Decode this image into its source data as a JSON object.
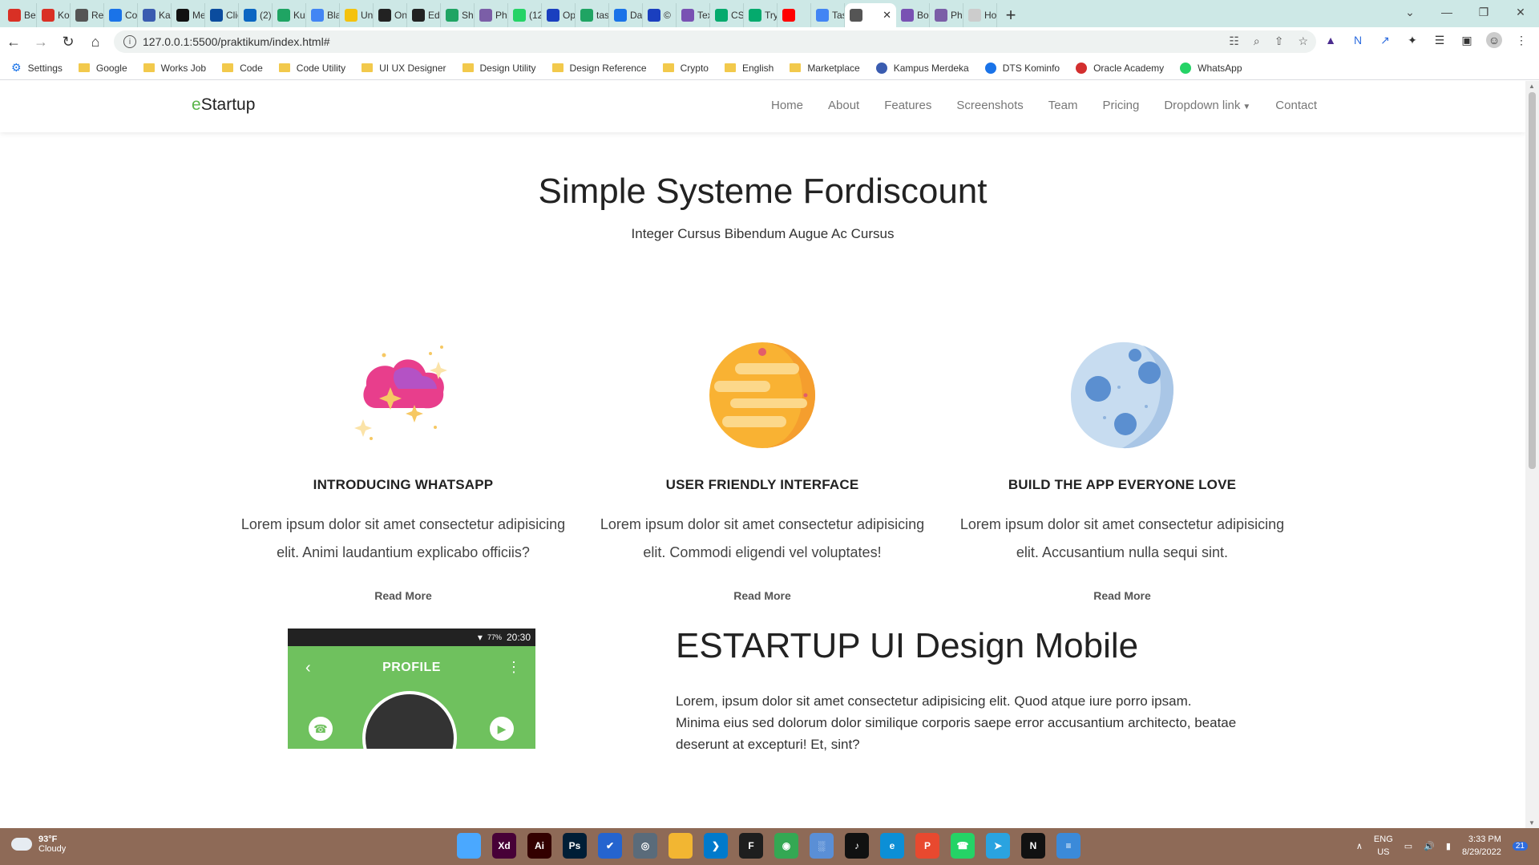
{
  "browser": {
    "tabs": [
      {
        "label": "Ber",
        "icon": "gmail-icon",
        "color": "#d93025"
      },
      {
        "label": "Kol",
        "icon": "gmail-icon",
        "color": "#d93025"
      },
      {
        "label": "Reg",
        "icon": "clock-icon",
        "color": "#555555"
      },
      {
        "label": "Co",
        "icon": "c-icon",
        "color": "#1a73e8"
      },
      {
        "label": "Kar",
        "icon": "karir-icon",
        "color": "#3a5cb0"
      },
      {
        "label": "Me",
        "icon": "medium-icon",
        "color": "#111111"
      },
      {
        "label": "Clic",
        "icon": "click-icon",
        "color": "#0b4c9e"
      },
      {
        "label": "(2)",
        "icon": "linkedin-icon",
        "color": "#0a66c2"
      },
      {
        "label": "Kul",
        "icon": "drive-icon",
        "color": "#1fa463"
      },
      {
        "label": "Bla",
        "icon": "docs-icon",
        "color": "#4285f4"
      },
      {
        "label": "Uni",
        "icon": "smile-icon",
        "color": "#f4c20d"
      },
      {
        "label": "On",
        "icon": "d-icon",
        "color": "#222222"
      },
      {
        "label": "Edi",
        "icon": "github-icon",
        "color": "#222222"
      },
      {
        "label": "Sha",
        "icon": "drive-icon",
        "color": "#1fa463"
      },
      {
        "label": "Phi",
        "icon": "grid-icon",
        "color": "#7b5ea7"
      },
      {
        "label": "(12",
        "icon": "whatsapp-icon",
        "color": "#25d366"
      },
      {
        "label": "Op",
        "icon": "b-icon",
        "color": "#1a3fbf"
      },
      {
        "label": "tas",
        "icon": "drive-icon",
        "color": "#1fa463"
      },
      {
        "label": "Da",
        "icon": "download-icon",
        "color": "#1a73e8"
      },
      {
        "label": "©",
        "icon": "heart-icon",
        "color": "#1a3fbf"
      },
      {
        "label": "Tex",
        "icon": "bootstrap-icon",
        "color": "#7952b3"
      },
      {
        "label": "CSS",
        "icon": "w-icon",
        "color": "#04aa6d"
      },
      {
        "label": "Try",
        "icon": "w-icon",
        "color": "#04aa6d"
      },
      {
        "label": "",
        "icon": "youtube-icon",
        "color": "#ff0000"
      },
      {
        "label": "Tas",
        "icon": "docs-icon",
        "color": "#4285f4"
      },
      {
        "label": "",
        "icon": "globe-icon",
        "color": "#555555",
        "active": true
      },
      {
        "label": "Bo",
        "icon": "bootstrap-icon",
        "color": "#7952b3"
      },
      {
        "label": "Phi",
        "icon": "grid-icon",
        "color": "#7b5ea7"
      },
      {
        "label": "Ho",
        "icon": "page-icon",
        "color": "#cccccc"
      }
    ],
    "url": "127.0.0.1:5500/praktikum/index.html#",
    "bookmarks": [
      {
        "label": "Settings",
        "type": "gear"
      },
      {
        "label": "Google",
        "type": "folder"
      },
      {
        "label": "Works Job",
        "type": "folder"
      },
      {
        "label": "Code",
        "type": "folder"
      },
      {
        "label": "Code Utility",
        "type": "folder"
      },
      {
        "label": "UI UX Designer",
        "type": "folder"
      },
      {
        "label": "Design Utility",
        "type": "folder"
      },
      {
        "label": "Design Reference",
        "type": "folder"
      },
      {
        "label": "Crypto",
        "type": "folder"
      },
      {
        "label": "English",
        "type": "folder"
      },
      {
        "label": "Marketplace",
        "type": "folder"
      },
      {
        "label": "Kampus Merdeka",
        "type": "site",
        "color": "#3a5cb0"
      },
      {
        "label": "DTS Kominfo",
        "type": "site",
        "color": "#1a73e8"
      },
      {
        "label": "Oracle Academy",
        "type": "site",
        "color": "#d32f2f"
      },
      {
        "label": "WhatsApp",
        "type": "site",
        "color": "#25d366"
      }
    ]
  },
  "site": {
    "brand_e": "e",
    "brand_rest": "Startup",
    "nav": [
      "Home",
      "About",
      "Features",
      "Screenshots",
      "Team",
      "Pricing",
      "Dropdown link",
      "Contact"
    ],
    "hero_title": "Simple Systeme Fordiscount",
    "hero_subtitle": "Integer Cursus Bibendum Augue Ac Cursus",
    "features": [
      {
        "title": "INTRODUCING WHATSAPP",
        "text": "Lorem ipsum dolor sit amet consectetur adipisicing elit. Animi laudantium explicabo officiis?",
        "link": "Read More"
      },
      {
        "title": "USER FRIENDLY INTERFACE",
        "text": "Lorem ipsum dolor sit amet consectetur adipisicing elit. Commodi eligendi vel voluptates!",
        "link": "Read More"
      },
      {
        "title": "BUILD THE APP EVERYONE LOVE",
        "text": "Lorem ipsum dolor sit amet consectetur adipisicing elit. Accusantium nulla sequi sint.",
        "link": "Read More"
      }
    ],
    "phone": {
      "status_battery": "77%",
      "status_time": "20:30",
      "title": "PROFILE"
    },
    "mobile_title": "ESTARTUP UI Design Mobile",
    "mobile_text": "Lorem, ipsum dolor sit amet consectetur adipisicing elit. Quod atque iure porro ipsam. Minima eius sed dolorum dolor similique corporis saepe error accusantium architecto, beatae deserunt at excepturi! Et, sint?"
  },
  "taskbar": {
    "weather_temp": "93°F",
    "weather_desc": "Cloudy",
    "lang_top": "ENG",
    "lang_bottom": "US",
    "time": "3:33 PM",
    "date": "8/29/2022",
    "notif_count": "21",
    "apps": [
      {
        "label": "",
        "icon": "windows-icon",
        "color": "#4aa8ff"
      },
      {
        "label": "Xd",
        "icon": "xd-icon",
        "color": "#470137"
      },
      {
        "label": "Ai",
        "icon": "illustrator-icon",
        "color": "#330000"
      },
      {
        "label": "Ps",
        "icon": "photoshop-icon",
        "color": "#001e36"
      },
      {
        "label": "✔",
        "icon": "todo-icon",
        "color": "#2564cf"
      },
      {
        "label": "◎",
        "icon": "settings-icon",
        "color": "#5a6b7a"
      },
      {
        "label": "",
        "icon": "explorer-icon",
        "color": "#f2b632"
      },
      {
        "label": "❯",
        "icon": "vscode-icon",
        "color": "#007acc"
      },
      {
        "label": "F",
        "icon": "figma-icon",
        "color": "#1e1e1e"
      },
      {
        "label": "◉",
        "icon": "chrome-icon",
        "color": "#34a853"
      },
      {
        "label": "░",
        "icon": "photos-icon",
        "color": "#5a8fd6"
      },
      {
        "label": "♪",
        "icon": "tiktok-icon",
        "color": "#111111"
      },
      {
        "label": "e",
        "icon": "edge-icon",
        "color": "#0c8fd6"
      },
      {
        "label": "P",
        "icon": "office-icon",
        "color": "#e8492f"
      },
      {
        "label": "☎",
        "icon": "whatsapp-icon",
        "color": "#25d366"
      },
      {
        "label": "➤",
        "icon": "telegram-icon",
        "color": "#2aa3e0"
      },
      {
        "label": "N",
        "icon": "notion-icon",
        "color": "#111111"
      },
      {
        "label": "≡",
        "icon": "notepad-icon",
        "color": "#3b8ad9"
      }
    ]
  }
}
